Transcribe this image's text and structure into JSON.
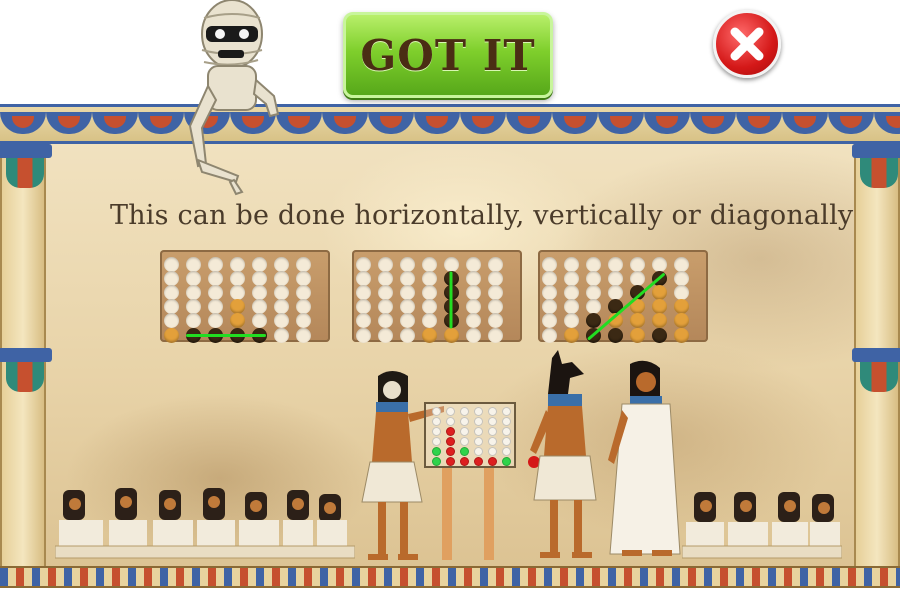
{
  "buttons": {
    "got_it_label": "GOT IT"
  },
  "icons": {
    "close": "close-x-icon",
    "mascot": "mummy-icon"
  },
  "instruction": "This can be done horizontally, vertically or diagonally",
  "colors": {
    "button_green": "#7fcf2c",
    "button_text": "#4a2d14",
    "close_red": "#d41818",
    "piece_orange": "#e3a03a",
    "piece_dark": "#3b2914",
    "line_green": "#22dd22",
    "frame_blue": "#3f63a5",
    "mini_red": "#dd1f1f",
    "mini_green": "#2fd34a"
  },
  "examples": [
    {
      "type": "horizontal",
      "grid": [
        "0000000",
        "0000000",
        "0000000",
        "000O000",
        "000O000",
        "ODDDD00"
      ],
      "line": {
        "from": [
          5,
          1
        ],
        "to": [
          5,
          4
        ]
      }
    },
    {
      "type": "vertical",
      "grid": [
        "0000000",
        "0000D00",
        "0000D00",
        "0000D00",
        "0000D00",
        "000OO00"
      ],
      "line": {
        "from": [
          1,
          4
        ],
        "to": [
          4,
          4
        ]
      }
    },
    {
      "type": "diagonal",
      "grid": [
        "0000000",
        "00000D0",
        "0000DO0",
        "000DOOO",
        "00DOOOO",
        "0ODDODO"
      ],
      "line": {
        "from": [
          5,
          2
        ],
        "to": [
          1,
          5
        ]
      }
    }
  ],
  "mini_board": {
    "grid": [
      "000000",
      "000000",
      "0R0000",
      "0R0000",
      "GRG000",
      "GRRRRG"
    ]
  }
}
